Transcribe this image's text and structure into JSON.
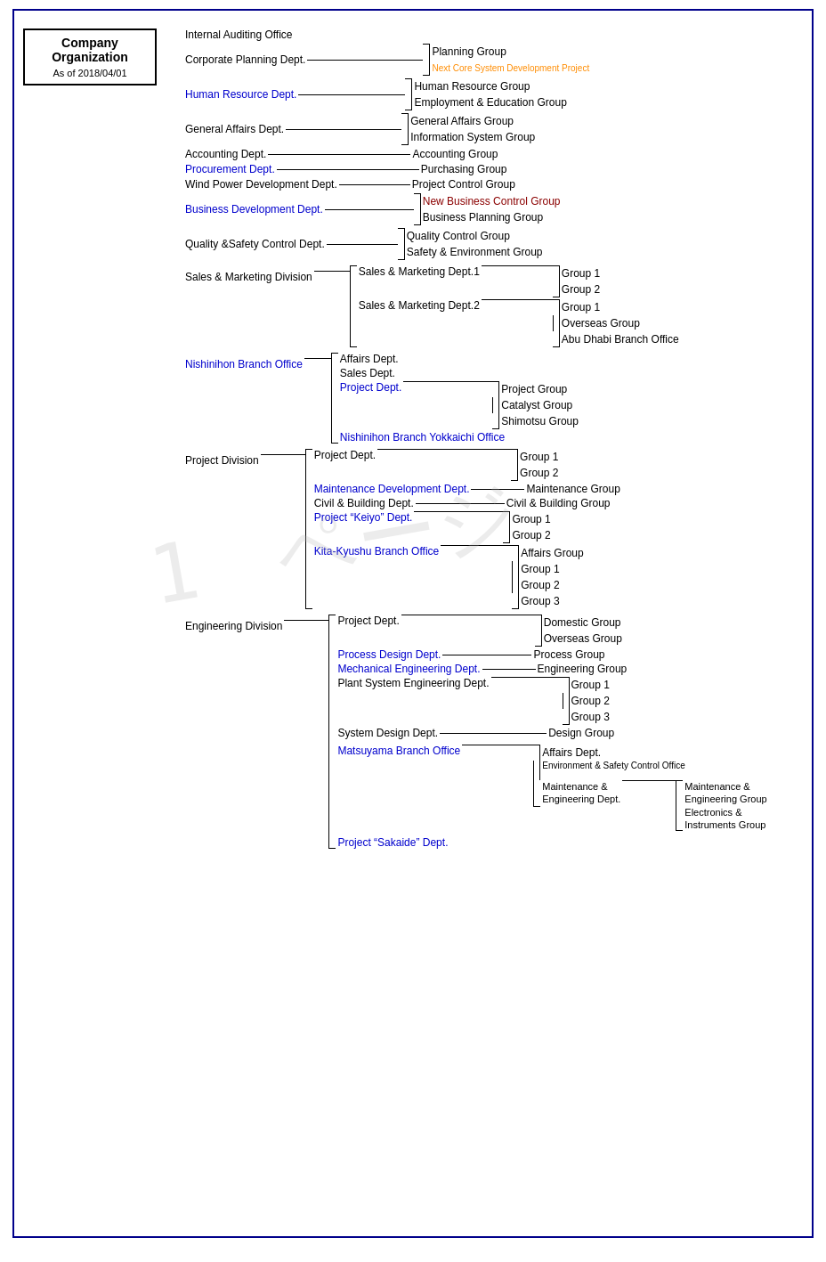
{
  "title": {
    "line1": "Company",
    "line2": "Organization",
    "line3": "As of 2018/04/01"
  },
  "watermark": "1ページ",
  "sections": {
    "top": {
      "internal_auditing": "Internal Auditing Office",
      "corp_planning_dept": "Corporate Planning Dept.",
      "planning_group": "Planning Group",
      "next_core": "Next Core System Development Project",
      "hr_dept": "Human Resource Dept.",
      "hr_group": "Human Resource Group",
      "employment_edu_group": "Employment & Education Group",
      "general_affairs_dept": "General Affairs Dept.",
      "general_affairs_group": "General Affairs Group",
      "info_system_group": "Information System Group",
      "accounting_dept": "Accounting Dept.",
      "accounting_group": "Accounting Group",
      "procurement_dept": "Procurement Dept.",
      "purchasing_group": "Purchasing Group",
      "wind_power_dept": "Wind Power Development Dept.",
      "project_control_group": "Project Control Group",
      "business_dev_dept": "Business Development Dept.",
      "new_business_group": "New Business Control Group",
      "business_planning_group": "Business Planning Group",
      "quality_safety_dept": "Quality &Safety Control Dept.",
      "quality_control_group": "Quality Control Group",
      "safety_env_group": "Safety & Environment Group"
    },
    "sales_marketing": {
      "division": "Sales & Marketing Division",
      "dept1": "Sales & Marketing Dept.1",
      "dept1_group1": "Group 1",
      "dept1_group2": "Group 2",
      "dept2": "Sales & Marketing Dept.2",
      "dept2_group1": "Group 1",
      "dept2_overseas": "Overseas Group",
      "dept2_abu_dhabi": "Abu Dhabi Branch Office"
    },
    "nishinihon": {
      "office": "Nishinihon Branch Office",
      "affairs_dept": "Affairs Dept.",
      "sales_dept": "Sales Dept.",
      "project_dept": "Project Dept.",
      "project_group": "Project Group",
      "catalyst_group": "Catalyst Group",
      "shimotsu_group": "Shimotsu Group",
      "yokkaichi": "Nishinihon Branch Yokkaichi Office"
    },
    "project": {
      "division": "Project Division",
      "project_dept": "Project Dept.",
      "project_group1": "Group 1",
      "project_group2": "Group 2",
      "maintenance_dev_dept": "Maintenance Development Dept.",
      "maintenance_group": "Maintenance Group",
      "civil_building_dept": "Civil & Building Dept.",
      "civil_building_group": "Civil & Building Group",
      "project_keiyo_dept": "Project “Keiyo” Dept.",
      "keiyo_group1": "Group 1",
      "keiyo_group2": "Group 2",
      "kita_kyushu": "Kita-Kyushu Branch Office",
      "affairs_group": "Affairs Group",
      "kk_group1": "Group 1",
      "kk_group2": "Group 2",
      "kk_group3": "Group 3"
    },
    "engineering": {
      "division": "Engineering Division",
      "project_dept": "Project Dept.",
      "domestic_group": "Domestic Group",
      "overseas_group": "Overseas Group",
      "process_design_dept": "Process Design Dept.",
      "process_group": "Process Group",
      "mechanical_eng_dept": "Mechanical Engineering Dept.",
      "engineering_group": "Engineering Group",
      "plant_system_dept": "Plant System Engineering Dept.",
      "plant_group1": "Group 1",
      "plant_group2": "Group 2",
      "plant_group3": "Group 3",
      "system_design_dept": "System Design Dept.",
      "design_group": "Design Group",
      "matsuyama": "Matsuyama Branch Office",
      "affairs_dept": "Affairs Dept.",
      "env_safety": "Environment & Safety Control Office",
      "maintenance_eng_dept": "Maintenance &\nEngineering Dept.",
      "maintenance_eng_group": "Maintenance &\nEngineering Group",
      "electronics_group": "Electronics &\nInstruments Group",
      "project_sakaide": "Project “Sakaide” Dept."
    }
  }
}
